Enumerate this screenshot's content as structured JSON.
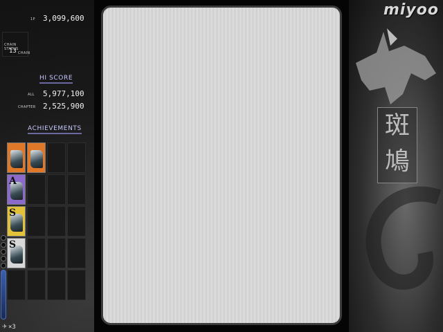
{
  "hud": {
    "score_label": "1P",
    "score": "3,099,600",
    "chain_status_label": "CHAIN STATUS",
    "chain_count": "13",
    "chain_unit": "CHAIN",
    "hiscore_heading": "HI SCORE",
    "all_label": "ALL",
    "all_value": "5,977,100",
    "chapter_label": "CHAPTER",
    "chapter_value": "2,525,900",
    "achievements_heading": "ACHIEVEMENTS",
    "lives": "×3"
  },
  "achievements": [
    {
      "slot": 1,
      "letter": "",
      "color": "#e0782a"
    },
    {
      "slot": 2,
      "letter": "",
      "color": "#e0782a"
    },
    {
      "slot": 3,
      "letter": "A",
      "color": "#8c6acb"
    },
    {
      "slot": 4,
      "letter": "S",
      "color": "#e2c23a"
    },
    {
      "slot": 5,
      "letter": "S",
      "color": "#d8d8d8"
    }
  ],
  "brand": "miyoo",
  "art": {
    "kanji_top": "斑",
    "kanji_bottom": "鳩"
  },
  "colors": {
    "accent": "#6a6aa0",
    "screen_stripe_light": "#f4f4f4",
    "screen_stripe_dark": "#b9b9b9"
  }
}
